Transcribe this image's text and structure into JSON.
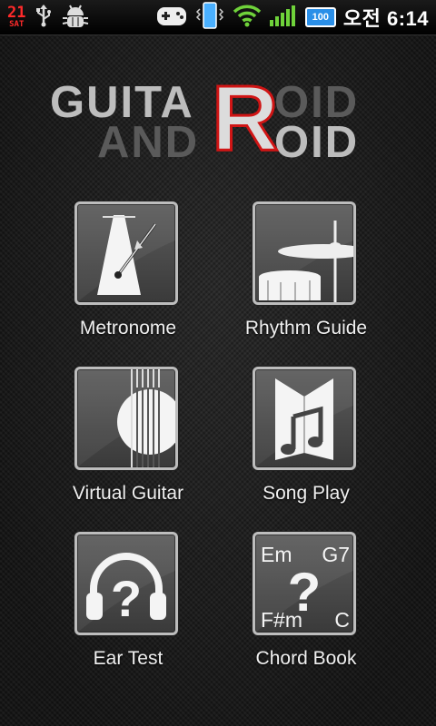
{
  "status_bar": {
    "date_day": "21",
    "date_weekday": "SAT",
    "battery_level": "100",
    "am_pm": "오전",
    "time": "6:14",
    "icons": [
      "usb-icon",
      "debug-bug-icon",
      "gamepad-icon",
      "phone-vibrate-icon",
      "wifi-icon",
      "signal-icon",
      "battery-icon"
    ]
  },
  "logo": {
    "line1_left": "GUITA",
    "line1_right": "OID",
    "line2_left": "AND",
    "line2_right": "OID",
    "big_letter": "R"
  },
  "menu": [
    {
      "label": "Metronome",
      "icon": "metronome-icon"
    },
    {
      "label": "Rhythm Guide",
      "icon": "drum-cymbal-icon"
    },
    {
      "label": "Virtual Guitar",
      "icon": "guitar-strings-icon"
    },
    {
      "label": "Song Play",
      "icon": "songbook-music-note-icon"
    },
    {
      "label": "Ear Test",
      "icon": "headphones-question-icon"
    },
    {
      "label": "Chord Book",
      "icon": "chord-book-icon"
    }
  ],
  "chord_tile": {
    "top_left": "Em",
    "top_right": "G7",
    "bottom_left": "F#m",
    "bottom_right": "C",
    "center": "?"
  },
  "ear_tile": {
    "center": "?"
  },
  "colors": {
    "logo_accent_red": "#d01515",
    "clock_text": "#ffffff",
    "date_red": "#ff2a2a",
    "battery_blue": "#2a8fe8"
  }
}
